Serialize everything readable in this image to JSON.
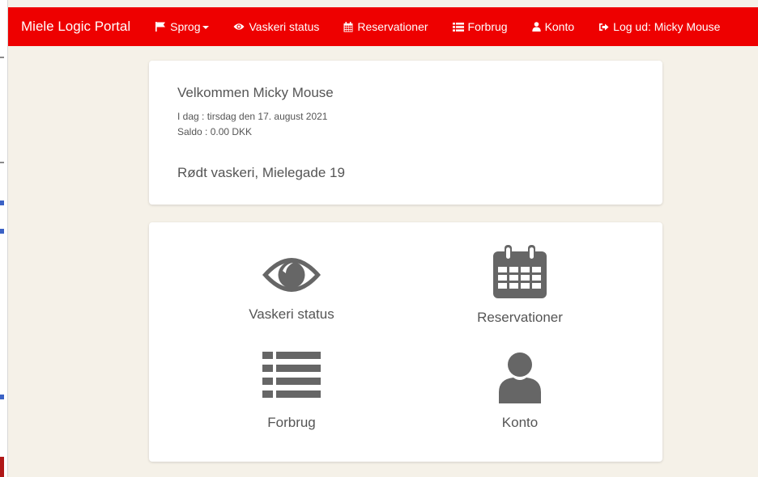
{
  "navbar": {
    "brand": "Miele Logic Portal",
    "background": "#ee0000",
    "items": [
      {
        "label": "Sprog",
        "icon": "flag-icon",
        "dropdown": true
      },
      {
        "label": "Vaskeri status",
        "icon": "eye-icon"
      },
      {
        "label": "Reservationer",
        "icon": "calendar-icon"
      },
      {
        "label": "Forbrug",
        "icon": "list-icon"
      },
      {
        "label": "Konto",
        "icon": "user-icon"
      },
      {
        "label": "Log ud: Micky Mouse",
        "icon": "sign-out-icon"
      }
    ]
  },
  "welcome": {
    "title": "Velkommen Micky Mouse",
    "date": "I dag : tirsdag den 17. august 2021",
    "balance": "Saldo : 0.00 DKK",
    "laundry": "Rødt vaskeri, Mielegade 19"
  },
  "menu": {
    "icon_color": "#666666",
    "tiles": [
      {
        "label": "Vaskeri status",
        "icon": "eye-icon"
      },
      {
        "label": "Reservationer",
        "icon": "calendar-icon"
      },
      {
        "label": "Forbrug",
        "icon": "list-icon"
      },
      {
        "label": "Konto",
        "icon": "user-icon"
      }
    ]
  }
}
